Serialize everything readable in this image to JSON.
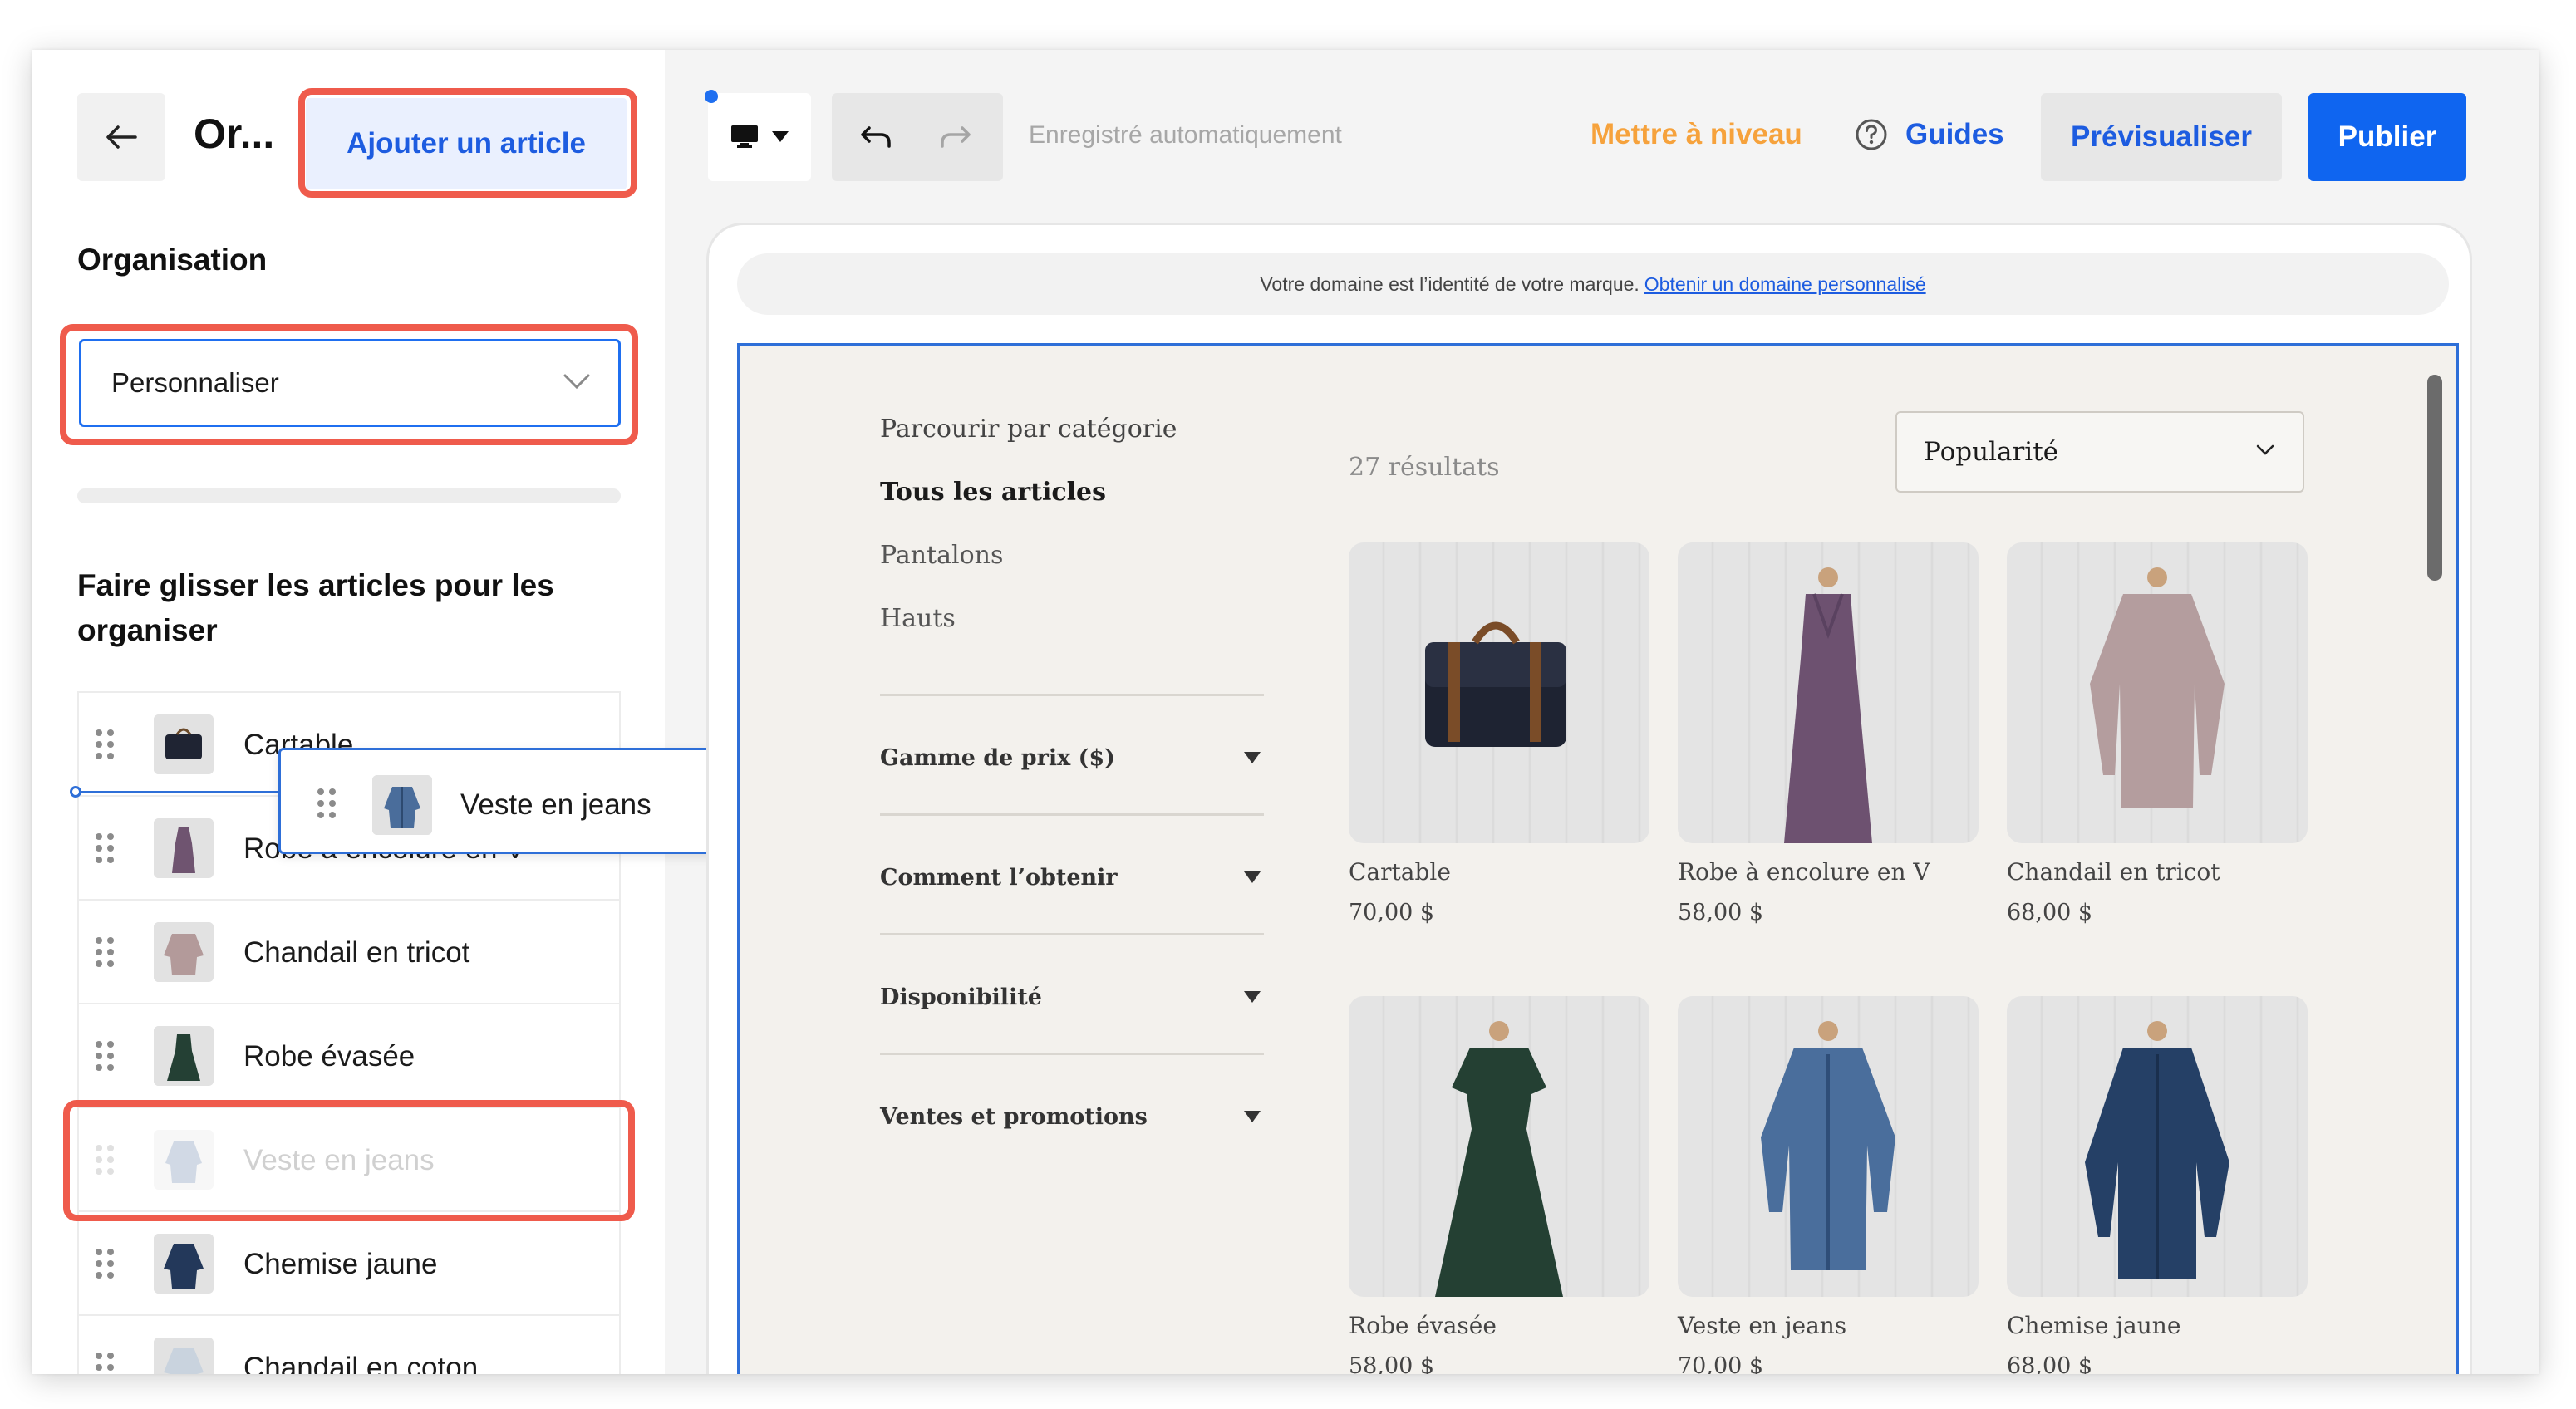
{
  "sidebar": {
    "title": "Or...",
    "add_button": "Ajouter un article",
    "organisation_heading": "Organisation",
    "organisation_select": "Personnaliser",
    "drag_heading": "Faire glisser les articles pour les organiser",
    "items": [
      {
        "label": "Cartable"
      },
      {
        "label": "Robe à encolure en V"
      },
      {
        "label": "Chandail en tricot"
      },
      {
        "label": "Robe évasée"
      },
      {
        "label": "Veste en jeans"
      },
      {
        "label": "Chemise jaune"
      },
      {
        "label": "Chandail en coton"
      }
    ],
    "dragging_item": "Veste en jeans"
  },
  "topbar": {
    "autosave": "Enregistré automatiquement",
    "upgrade": "Mettre à niveau",
    "guides": "Guides",
    "preview": "Prévisualiser",
    "publish": "Publier"
  },
  "domain_banner": {
    "text": "Votre domaine est l’identité de votre marque.",
    "link": "Obtenir un domaine personnalisé"
  },
  "shop": {
    "browse_title": "Parcourir par catégorie",
    "categories": [
      {
        "label": "Tous les articles",
        "active": true
      },
      {
        "label": "Pantalons",
        "active": false
      },
      {
        "label": "Hauts",
        "active": false
      }
    ],
    "filters": [
      "Gamme de prix ($)",
      "Comment l’obtenir",
      "Disponibilité",
      "Ventes et promotions"
    ],
    "results": "27 résultats",
    "sort": "Popularité",
    "products": [
      {
        "name": "Cartable",
        "price": "70,00 $"
      },
      {
        "name": "Robe à encolure en V",
        "price": "58,00 $"
      },
      {
        "name": "Chandail en tricot",
        "price": "68,00 $"
      },
      {
        "name": "Robe évasée",
        "price": "58,00 $"
      },
      {
        "name": "Veste en jeans",
        "price": "70,00 $"
      },
      {
        "name": "Chemise jaune",
        "price": "68,00 $"
      }
    ]
  },
  "colors": {
    "highlight": "#ef5b4c",
    "accent": "#1d5ce0",
    "upgrade": "#f6a23c",
    "publish": "#0f65f0"
  }
}
